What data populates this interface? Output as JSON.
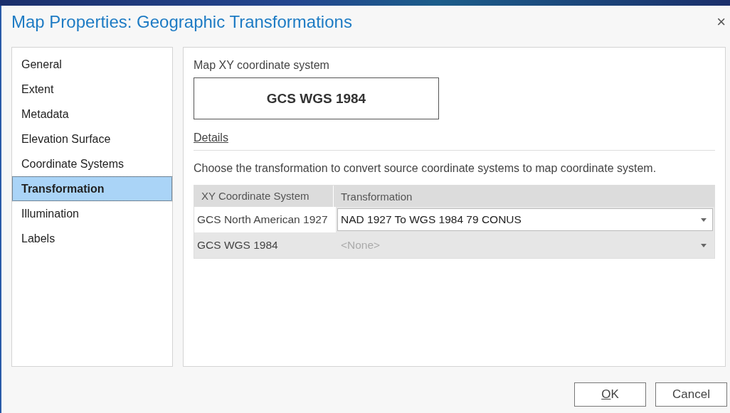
{
  "window": {
    "title": "Map Properties: Geographic Transformations",
    "close": "×"
  },
  "sidebar": {
    "items": [
      {
        "label": "General",
        "selected": false
      },
      {
        "label": "Extent",
        "selected": false
      },
      {
        "label": "Metadata",
        "selected": false
      },
      {
        "label": "Elevation Surface",
        "selected": false
      },
      {
        "label": "Coordinate Systems",
        "selected": false
      },
      {
        "label": "Transformation",
        "selected": true
      },
      {
        "label": "Illumination",
        "selected": false
      },
      {
        "label": "Labels",
        "selected": false
      }
    ]
  },
  "panel": {
    "coordinate_system_label": "Map XY coordinate system",
    "coordinate_system": "GCS WGS 1984",
    "details_link": "Details",
    "instruction": "Choose the transformation to convert source coordinate systems to map coordinate system.",
    "table": {
      "columns": [
        "XY Coordinate System",
        "Transformation"
      ],
      "rows": [
        {
          "system": "GCS North American 1927",
          "transformation": "NAD 1927 To WGS 1984 79 CONUS",
          "placeholder": false,
          "disabled": false
        },
        {
          "system": "GCS WGS 1984",
          "transformation": "<None>",
          "placeholder": true,
          "disabled": true
        }
      ]
    }
  },
  "buttons": [
    {
      "label": "OK",
      "access_key_underlined": true
    },
    {
      "label": "Cancel",
      "access_key_underlined": false
    }
  ]
}
